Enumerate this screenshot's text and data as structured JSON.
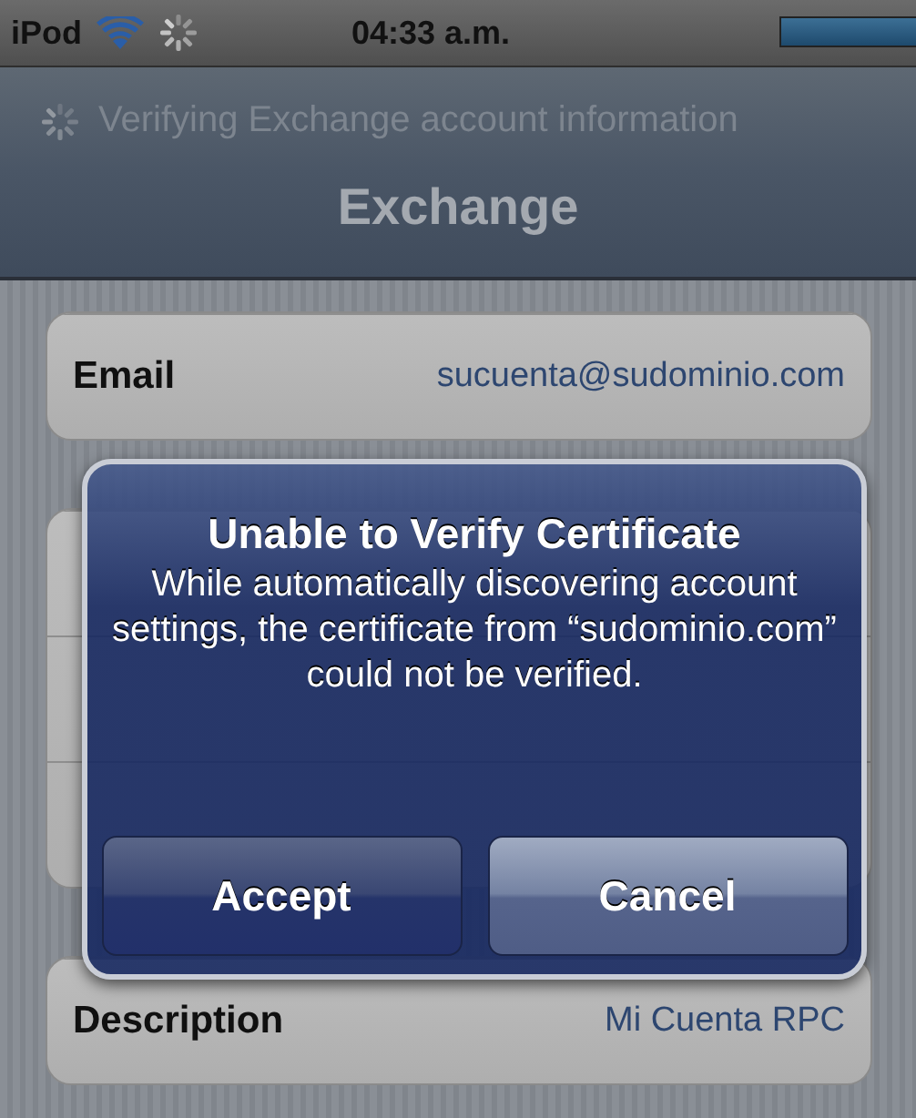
{
  "status_bar": {
    "carrier": "iPod",
    "time": "04:33 a.m."
  },
  "prompt": "Verifying Exchange account information",
  "title": "Exchange",
  "groups": [
    {
      "rows": [
        {
          "label": "Email",
          "value": "sucuenta@sudominio.com"
        }
      ]
    },
    {
      "kind": "covered"
    },
    {
      "rows": [
        {
          "label": "Description",
          "value": "Mi Cuenta RPC"
        }
      ]
    }
  ],
  "alert": {
    "title": "Unable to Verify Certificate",
    "message": "While automatically discovering account settings, the certificate from “sudominio.com” could not be verified.",
    "buttons": [
      "Accept",
      "Cancel"
    ]
  }
}
